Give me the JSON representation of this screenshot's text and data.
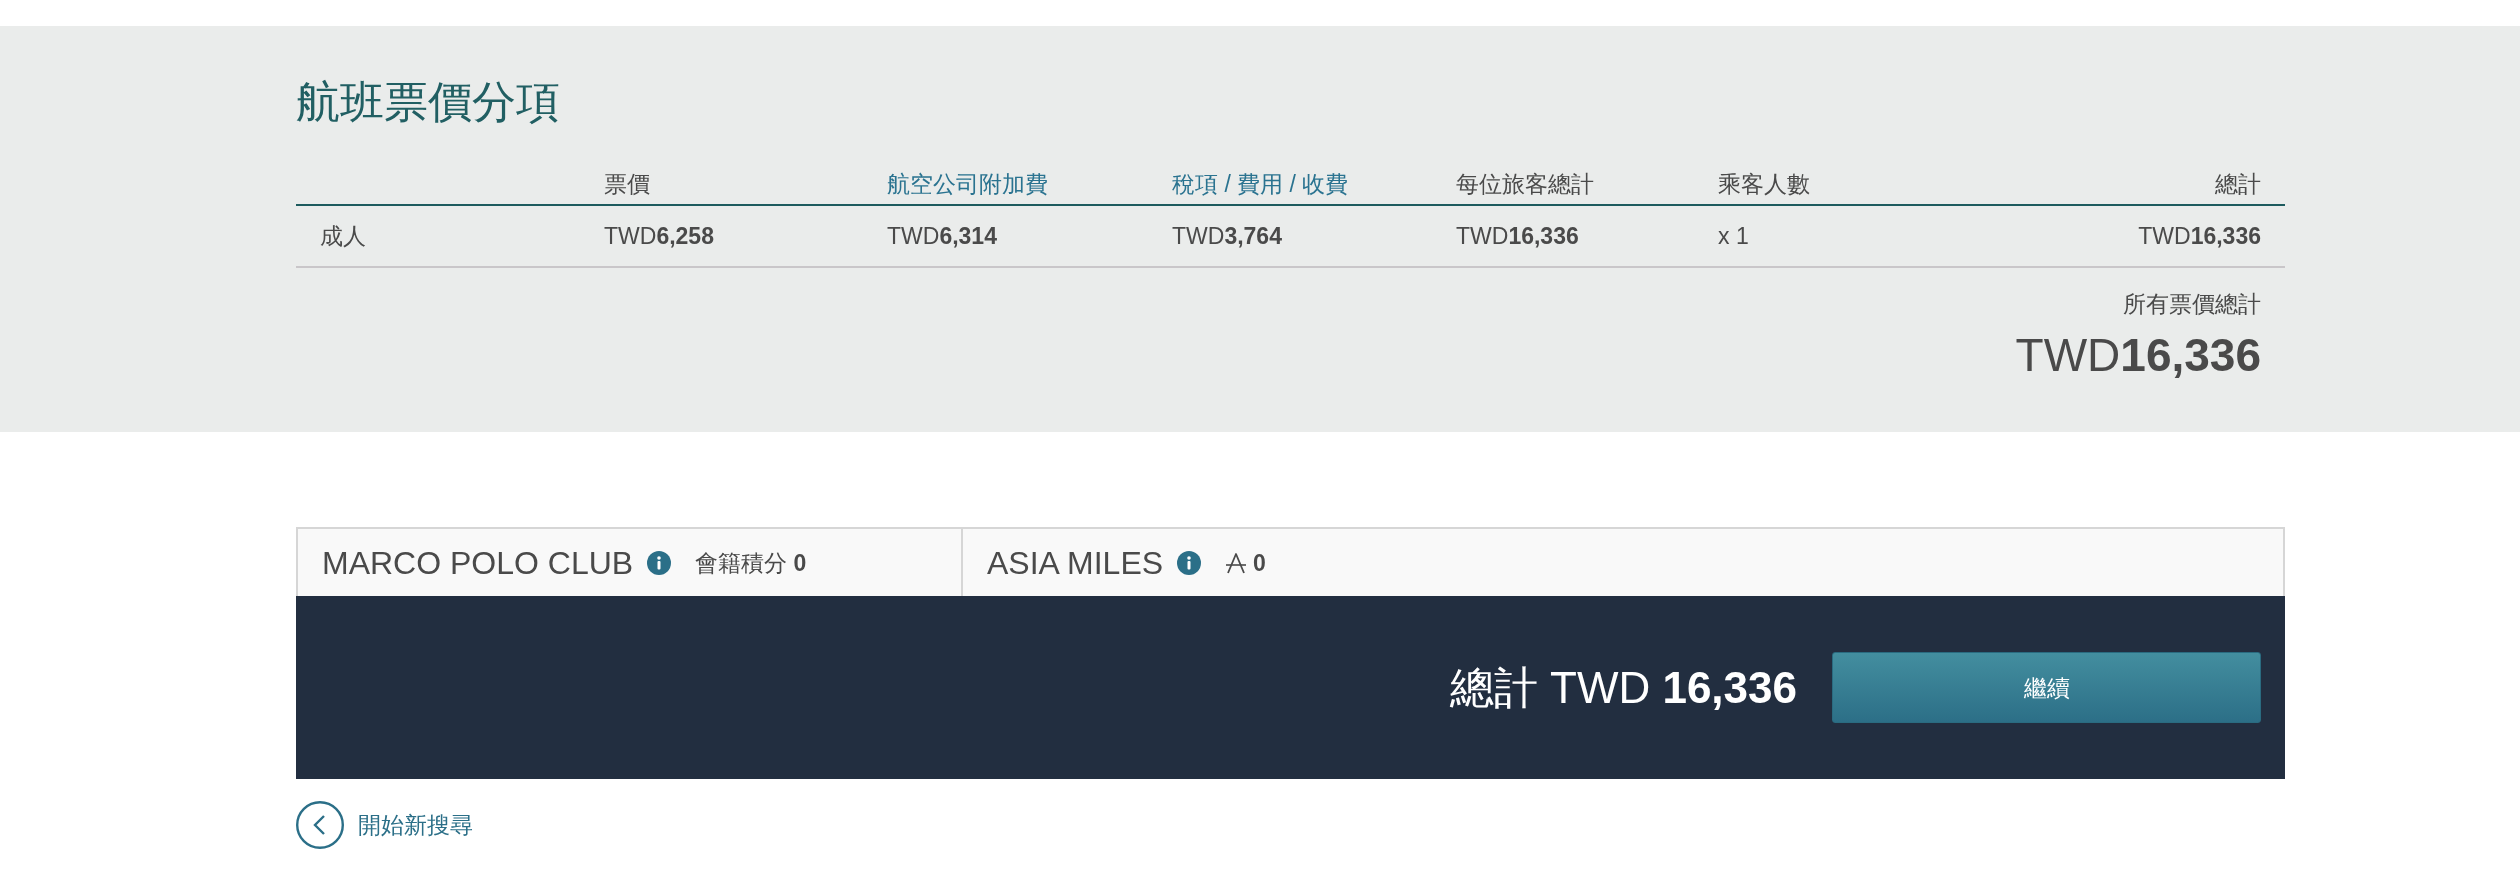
{
  "fare_breakdown": {
    "title": "航班票價分項",
    "columns": [
      {
        "label": "票價",
        "kind": "text"
      },
      {
        "label": "航空公司附加費",
        "kind": "link"
      },
      {
        "label": "稅項 / 費用 / 收費",
        "kind": "link"
      },
      {
        "label": "每位旅客總計",
        "kind": "text"
      },
      {
        "label": "乘客人數",
        "kind": "text"
      },
      {
        "label": "總計",
        "kind": "text"
      }
    ],
    "rows": [
      {
        "label": "成人",
        "cells": [
          "TWD**6,258**",
          "TWD**6,314**",
          "TWD**3,764**",
          "TWD**16,336**",
          "x 1",
          "TWD**16,336**"
        ]
      }
    ],
    "grand_total": {
      "label": "所有票價總計",
      "amount": "TWD**16,336**"
    }
  },
  "loyalty": [
    {
      "name": "MARCO POLO CLUB",
      "kind": "points",
      "value": "會籍積分 **0**"
    },
    {
      "name": "ASIA MILES",
      "kind": "miles",
      "value": "0"
    }
  ],
  "checkout_bar": {
    "total": "總計 TWD **16,336**",
    "button": "繼續"
  },
  "back_link": "開始新搜尋"
}
